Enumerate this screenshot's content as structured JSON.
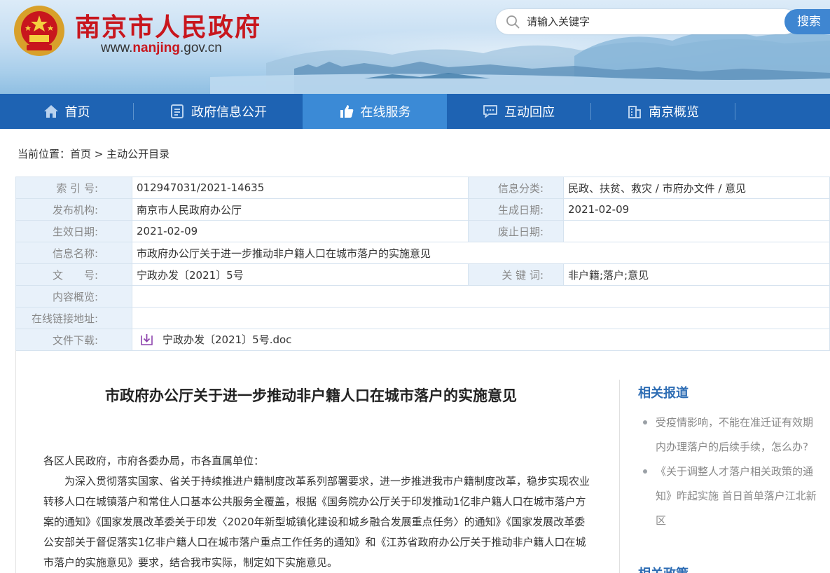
{
  "header": {
    "site_title": "南京市人民政府",
    "url_prefix": "www.",
    "url_domain": "nanjing",
    "url_suffix": ".gov.cn",
    "search_placeholder": "请输入关键字",
    "search_button": "搜索",
    "colors": {
      "title_red": "#c8161d",
      "nav_blue": "#1e63b3",
      "nav_active": "#3b8ad6"
    }
  },
  "nav": {
    "items": [
      {
        "label": "首页",
        "icon": "home-icon"
      },
      {
        "label": "政府信息公开",
        "icon": "document-icon"
      },
      {
        "label": "在线服务",
        "icon": "thumbs-up-icon",
        "active": true
      },
      {
        "label": "互动回应",
        "icon": "chat-icon"
      },
      {
        "label": "南京概览",
        "icon": "building-icon"
      }
    ]
  },
  "breadcrumb": {
    "prefix": "当前位置：",
    "home": "首页",
    "sep": " > ",
    "current": "主动公开目录"
  },
  "meta": {
    "index_label": "索 引 号:",
    "index_value": "012947031/2021-14635",
    "category_label": "信息分类:",
    "category_value": "民政、扶贫、救灾 / 市府办文件 / 意见",
    "issuer_label": "发布机构:",
    "issuer_value": "南京市人民政府办公厅",
    "created_label": "生成日期:",
    "created_value": "2021-02-09",
    "effective_label": "生效日期:",
    "effective_value": "2021-02-09",
    "abolish_label": "废止日期:",
    "abolish_value": "",
    "name_label": "信息名称:",
    "name_value": "市政府办公厅关于进一步推动非户籍人口在城市落户的实施意见",
    "docno_label": "文　　号:",
    "docno_value": "宁政办发〔2021〕5号",
    "keywords_label": "关 键 词:",
    "keywords_value": "非户籍;落户;意见",
    "summary_label": "内容概览:",
    "summary_value": "",
    "link_label": "在线链接地址:",
    "link_value": "",
    "download_label": "文件下载:",
    "download_value": "宁政办发〔2021〕5号.doc"
  },
  "article": {
    "title": "市政府办公厅关于进一步推动非户籍人口在城市落户的实施意见",
    "salutation": "各区人民政府，市府各委办局，市各直属单位：",
    "para1": "为深入贯彻落实国家、省关于持续推进户籍制度改革系列部署要求，进一步推进我市户籍制度改革，稳步实现农业转移人口在城镇落户和常住人口基本公共服务全覆盖，根据《国务院办公厅关于印发推动1亿非户籍人口在城市落户方案的通知》《国家发展改革委关于印发〈2020年新型城镇化建设和城乡融合发展重点任务〉的通知》《国家发展改革委公安部关于督促落实1亿非户籍人口在城市落户重点工作任务的通知》和《江苏省政府办公厅关于推动非户籍人口在城市落户的实施意见》要求，结合我市实际，制定如下实施意见。"
  },
  "related": {
    "title": "相关报道",
    "items": [
      "受疫情影响，不能在准迁证有效期内办理落户的后续手续，怎么办?",
      "《关于调整人才落户相关政策的通知》昨起实施 首日首单落户江北新区"
    ],
    "title2": "相关政策"
  }
}
